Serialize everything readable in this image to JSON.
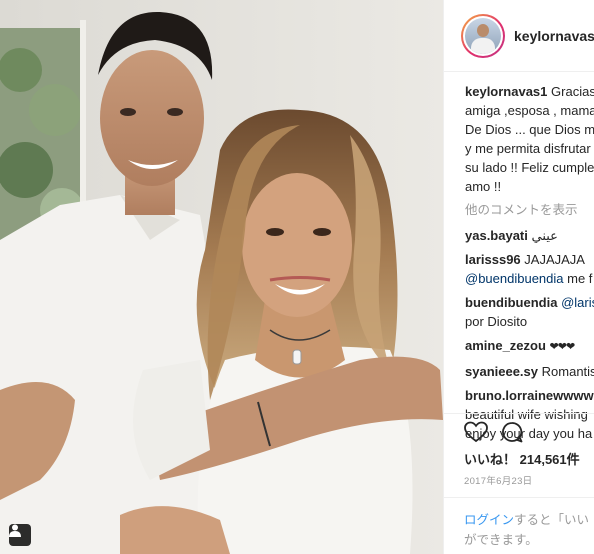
{
  "post": {
    "username": "keylornavas1",
    "caption_lines": [
      "Gracias",
      "amiga ,esposa , mama",
      "De Dios ... que Dios m",
      "y me permita disfrutar",
      "su lado !! Feliz cumple",
      "amo !!"
    ],
    "view_all_comments": "他のコメントを表示",
    "comments": [
      {
        "user": "yas.bayati",
        "text": "عيني"
      },
      {
        "user": "larisss96",
        "text": "JAJAJAJA",
        "line2_mention": "@buendibuendia",
        "line2_text": "me f"
      },
      {
        "user": "buendibuendia",
        "mention": "@laris",
        "line2_text": "por Diosito"
      },
      {
        "user": "amine_zezou",
        "text": "❤❤❤"
      },
      {
        "user": "syanieee.sy",
        "text": "Romantis"
      },
      {
        "user": "bruno.lorrainewwww",
        "line2_text": "beautiful wife wishing",
        "line3_text": "enjoy your day you ha"
      }
    ],
    "likes_label": "いいね！",
    "likes_count": "214,561件",
    "date": "2017年6月23日",
    "login_link": "ログイン",
    "login_text_1": "すると「いい",
    "login_text_2": "ができます。"
  },
  "icons": {
    "like": "heart-icon",
    "comment": "comment-bubble-icon",
    "tag": "user-tag-icon"
  },
  "colors": {
    "link": "#003569",
    "login_link": "#3897f0",
    "muted": "#999999",
    "text": "#262626"
  }
}
